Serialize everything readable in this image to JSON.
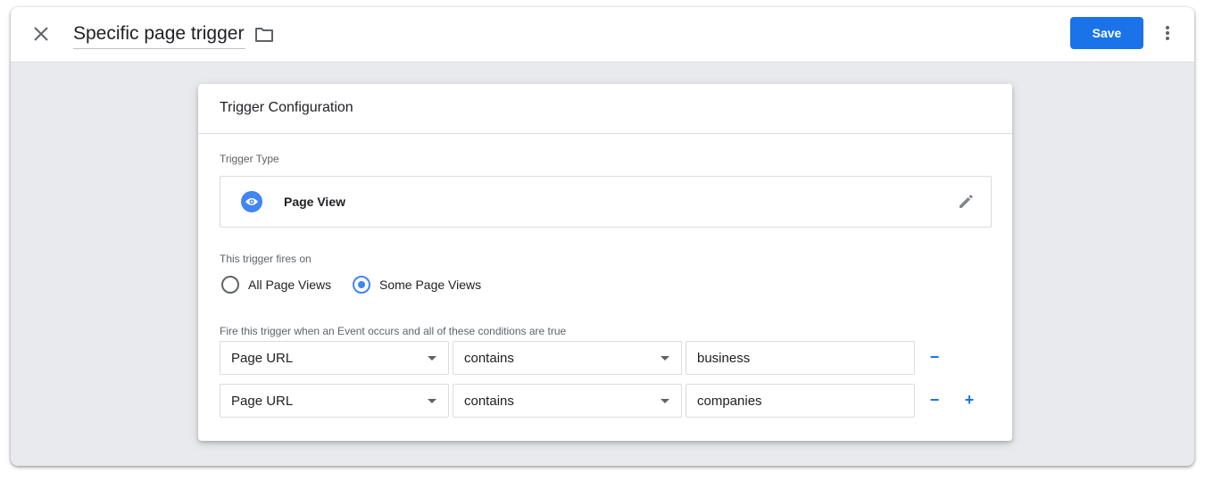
{
  "header": {
    "title": "Specific page trigger",
    "close_icon": "close-icon",
    "folder_icon": "folder-icon",
    "save_label": "Save",
    "more_icon": "more-vert-icon"
  },
  "card": {
    "title": "Trigger Configuration",
    "trigger_type_label": "Trigger Type",
    "trigger_type": {
      "icon": "eye-icon",
      "name": "Page View",
      "edit_icon": "pencil-icon"
    },
    "fires_on_label": "This trigger fires on",
    "fires_on_options": [
      {
        "label": "All Page Views",
        "selected": false
      },
      {
        "label": "Some Page Views",
        "selected": true
      }
    ],
    "conditions_label": "Fire this trigger when an Event occurs and all of these conditions are true",
    "conditions": [
      {
        "variable": "Page URL",
        "operator": "contains",
        "value": "business",
        "remove": "−"
      },
      {
        "variable": "Page URL",
        "operator": "contains",
        "value": "companies",
        "remove": "−",
        "add": "+"
      }
    ]
  },
  "colors": {
    "accent": "#1a73e8",
    "icon_blue": "#4285f4",
    "background": "#e8eaed"
  }
}
